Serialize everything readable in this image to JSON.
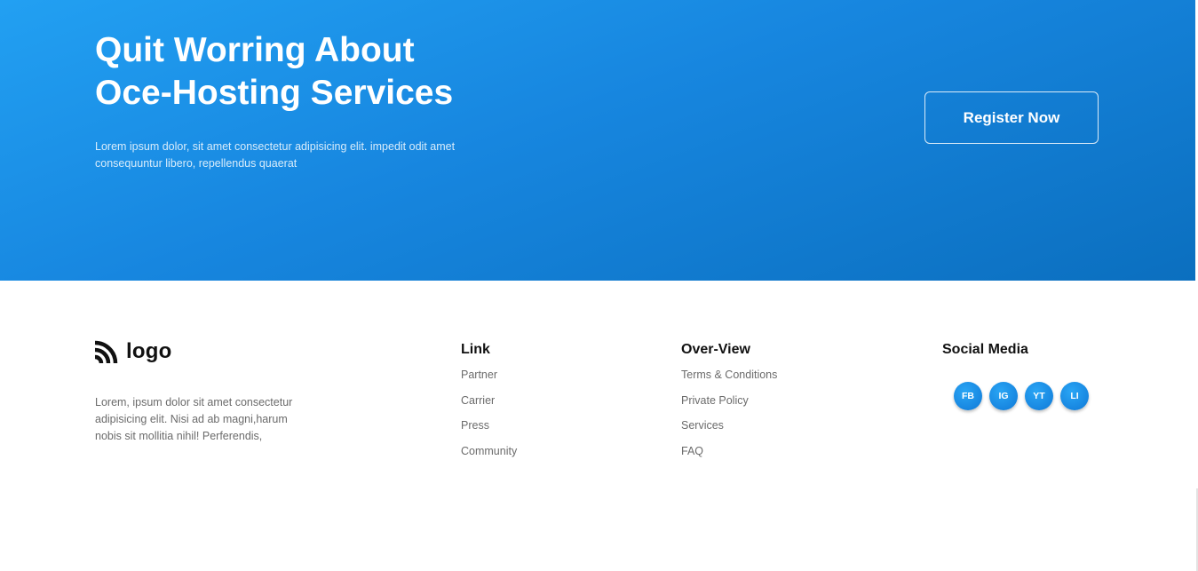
{
  "hero": {
    "title_line1": "Quit Worring About",
    "title_line2": "Oce-Hosting Services",
    "description": "Lorem ipsum dolor, sit amet consectetur adipisicing elit. impedit odit amet consequuntur libero, repellendus quaerat",
    "register_label": "Register Now"
  },
  "footer": {
    "logo_text": "logo",
    "description": "Lorem, ipsum dolor sit amet consectetur adipisicing elit. Nisi ad ab magni,harum nobis sit mollitia nihil! Perferendis,",
    "link": {
      "heading": "Link",
      "items": [
        "Partner",
        "Carrier",
        "Press",
        "Community"
      ]
    },
    "overview": {
      "heading": "Over-View",
      "items": [
        "Terms & Conditions",
        "Private Policy",
        "Services",
        "FAQ"
      ]
    },
    "social": {
      "heading": "Social Media",
      "items": [
        "FB",
        "IG",
        "YT",
        "LI"
      ]
    }
  },
  "colors": {
    "hero_start": "#22a0f2",
    "hero_end": "#0b6fbf",
    "accent": "#1786e0",
    "muted_text": "#6b6b6b"
  }
}
